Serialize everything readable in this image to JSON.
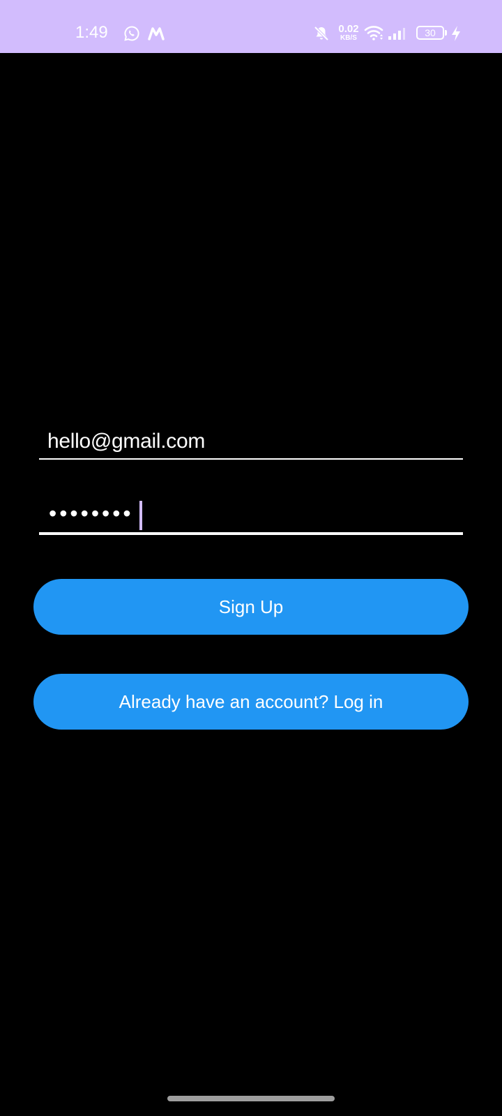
{
  "status_bar": {
    "time": "1:49",
    "net_speed_value": "0.02",
    "net_speed_unit": "KB/S",
    "battery_level": "30",
    "background_color": "#d2bcfd",
    "icons": [
      "whatsapp-icon",
      "gmail-icon",
      "bell-muted-icon",
      "wifi-icon",
      "signal-icon",
      "battery-icon",
      "charging-bolt-icon"
    ]
  },
  "form": {
    "email_value": "hello@gmail.com",
    "password_masked": "••••••••"
  },
  "buttons": {
    "signup_label": "Sign Up",
    "login_label": "Already have an account? Log in",
    "color": "#2196f3"
  }
}
